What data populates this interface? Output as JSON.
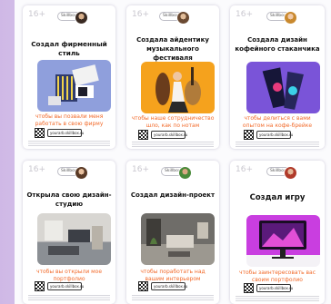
{
  "cards": [
    {
      "age": "16+",
      "pill": "Skillbox",
      "title": "Создал фирменный стиль",
      "subtitle": "чтобы вы позвали меня работать в свою фирму",
      "url": "yourarb.skillbox.ru"
    },
    {
      "age": "16+",
      "pill": "Skillbox",
      "title": "Создала айдентику музыкального фестиваля",
      "subtitle": "чтобы наше сотрудничество шло, как по нотам",
      "url": "yourarb.skillbox.ru"
    },
    {
      "age": "16+",
      "pill": "Skillbox",
      "title": "Создала дизайн кофейного стаканчика",
      "subtitle": "чтобы делиться с вами опытом на кофе-брейке",
      "url": "yourarb.skillbox.ru"
    },
    {
      "age": "16+",
      "pill": "Skillbox",
      "title": "Открыла свою дизайн-студию",
      "subtitle": "чтобы вы открыли мое портфолио",
      "url": "yourarb.skillbox.ru"
    },
    {
      "age": "16+",
      "pill": "Skillbox",
      "title": "Создал дизайн-проект",
      "subtitle": "чтобы поработать над вашим интерьером",
      "url": "yourarb.skillbox.ru"
    },
    {
      "age": "16+",
      "pill": "Skillbox",
      "title": "Создал игру",
      "subtitle": "чтобы заинтересовать вас своим портфолио",
      "url": "yourarb.skillbox.ru"
    }
  ],
  "colors": {
    "accent": "#f26a2a",
    "background": "#d9c8ea"
  }
}
